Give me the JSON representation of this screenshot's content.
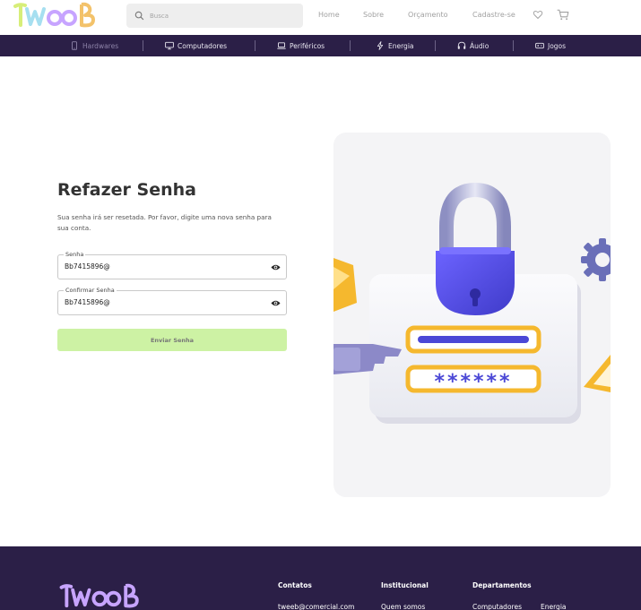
{
  "brand": {
    "name": "TWeeB"
  },
  "search": {
    "placeholder": "Busca"
  },
  "topnav": [
    "Home",
    "Sobre",
    "Orçamento",
    "Cadastre-se"
  ],
  "icons": {
    "heart": "heart-icon",
    "cart": "cart-icon",
    "search": "search-icon",
    "eye": "eye-icon"
  },
  "categories": [
    {
      "label": "Hardwares",
      "icon": "smartphone-icon",
      "active": true
    },
    {
      "label": "Computadores",
      "icon": "monitor-icon"
    },
    {
      "label": "Periféricos",
      "icon": "laptop-icon"
    },
    {
      "label": "Energia",
      "icon": "bolt-icon"
    },
    {
      "label": "Áudio",
      "icon": "headphones-icon"
    },
    {
      "label": "Jogos",
      "icon": "gamepad-icon"
    }
  ],
  "form": {
    "title": "Refazer Senha",
    "description": "Sua senha irá ser resetada. Por favor, digite uma nova senha para sua conta.",
    "password_label": "Senha",
    "password_value": "Bb7415896@",
    "confirm_label": "Confirmar Senha",
    "confirm_value": "Bb7415896@",
    "submit_label": "Enviar Senha"
  },
  "illustration": {
    "password_mask": "******"
  },
  "footer": {
    "contacts_title": "Contatos",
    "contacts_email": "tweeb@comercial.com",
    "institutional_title": "Institucional",
    "institutional_link": "Quem somos",
    "departments_title": "Departamentos",
    "departments_links": [
      "Computadores",
      "Energia"
    ]
  },
  "colors": {
    "nav_bg": "#2b1f47",
    "accent_purple": "#4b48d6",
    "button_green": "#cdf2a4",
    "lock_gold": "#f5b82e",
    "logo_purple": "#c7a4ff"
  }
}
